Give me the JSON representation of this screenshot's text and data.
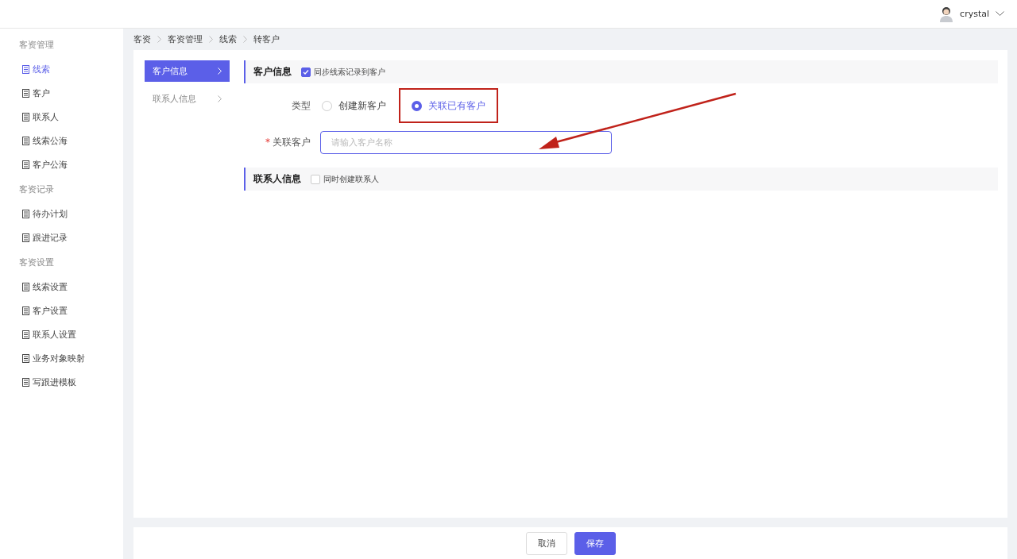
{
  "header": {
    "username": "crystal"
  },
  "sidebar": {
    "groups": [
      {
        "title": "客资管理",
        "items": [
          {
            "label": "线索",
            "selected": true
          },
          {
            "label": "客户",
            "selected": false
          },
          {
            "label": "联系人",
            "selected": false
          },
          {
            "label": "线索公海",
            "selected": false
          },
          {
            "label": "客户公海",
            "selected": false
          }
        ]
      },
      {
        "title": "客资记录",
        "items": [
          {
            "label": "待办计划",
            "selected": false
          },
          {
            "label": "跟进记录",
            "selected": false
          }
        ]
      },
      {
        "title": "客资设置",
        "items": [
          {
            "label": "线索设置",
            "selected": false
          },
          {
            "label": "客户设置",
            "selected": false
          },
          {
            "label": "联系人设置",
            "selected": false
          },
          {
            "label": "业务对象映射",
            "selected": false
          },
          {
            "label": "写跟进模板",
            "selected": false
          }
        ]
      }
    ]
  },
  "breadcrumb": [
    "客资",
    "客资管理",
    "线索",
    "转客户"
  ],
  "section_nav": [
    {
      "label": "客户信息",
      "selected": true
    },
    {
      "label": "联系人信息",
      "selected": false
    }
  ],
  "customer_section": {
    "title": "客户信息",
    "checkbox": {
      "label": "同步线索记录到客户",
      "checked": true
    },
    "type_field": {
      "label": "类型",
      "options": [
        {
          "label": "创建新客户",
          "selected": false,
          "highlighted": false
        },
        {
          "label": "关联已有客户",
          "selected": true,
          "highlighted": true
        }
      ]
    },
    "customer_field": {
      "label": "关联客户",
      "required_mark": "*",
      "placeholder": "请输入客户名称"
    }
  },
  "contact_section": {
    "title": "联系人信息",
    "checkbox": {
      "label": "同时创建联系人",
      "checked": false
    }
  },
  "buttons": [
    {
      "label": "取消",
      "kind": "secondary"
    },
    {
      "label": "保存",
      "kind": "primary"
    }
  ]
}
